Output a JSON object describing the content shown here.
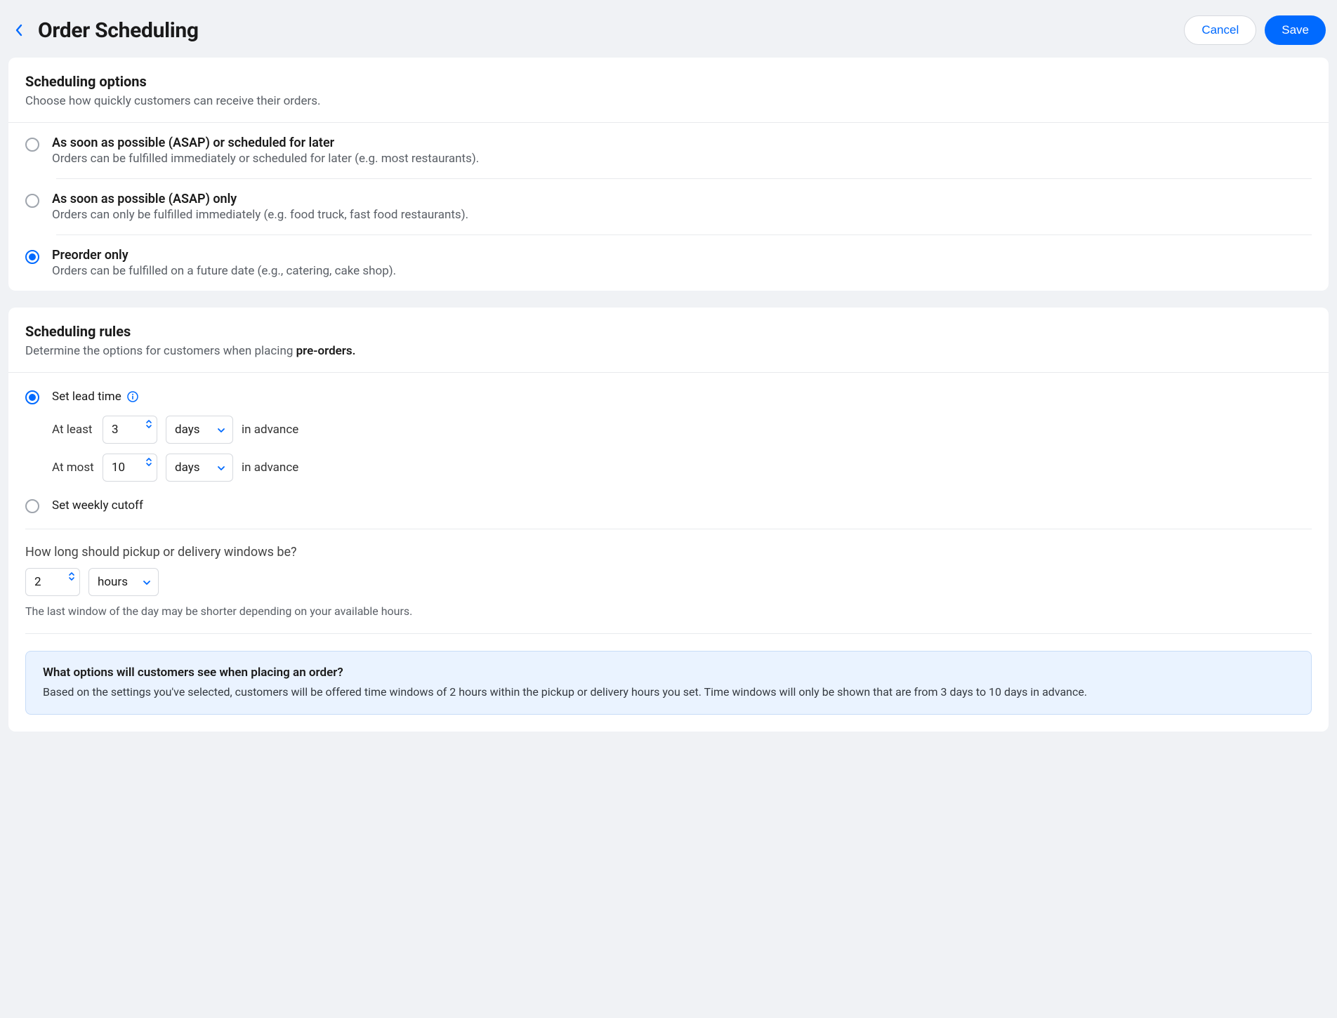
{
  "header": {
    "title": "Order Scheduling",
    "cancel": "Cancel",
    "save": "Save"
  },
  "schedulingOptions": {
    "title": "Scheduling options",
    "subtitle": "Choose how quickly customers can receive their orders.",
    "items": [
      {
        "title": "As soon as possible (ASAP) or scheduled for later",
        "desc": "Orders can be fulfilled immediately or scheduled for later (e.g. most restaurants).",
        "checked": false
      },
      {
        "title": "As soon as possible (ASAP) only",
        "desc": "Orders can only be fulfilled immediately (e.g. food truck, fast food restaurants).",
        "checked": false
      },
      {
        "title": "Preorder only",
        "desc": "Orders can be fulfilled on a future date (e.g., catering, cake shop).",
        "checked": true
      }
    ]
  },
  "schedulingRules": {
    "title": "Scheduling rules",
    "subtitlePrefix": "Determine the options for customers when placing ",
    "subtitleBold": "pre-orders.",
    "leadTime": {
      "label": "Set lead time",
      "checked": true,
      "atLeastLabel": "At least",
      "atLeastValue": "3",
      "atLeastUnit": "days",
      "atMostLabel": "At most",
      "atMostValue": "10",
      "atMostUnit": "days",
      "tail": "in advance"
    },
    "weeklyCutoff": {
      "label": "Set weekly cutoff",
      "checked": false
    },
    "windows": {
      "question": "How long should pickup or delivery windows be?",
      "value": "2",
      "unit": "hours",
      "hint": "The last window of the day may be shorter depending on your available hours."
    },
    "infoBox": {
      "title": "What options will customers see when placing an order?",
      "body": "Based on the settings you've selected, customers will be offered time windows of 2 hours within the pickup or delivery hours you set. Time windows will only be shown that are from 3 days to 10 days in advance."
    }
  }
}
